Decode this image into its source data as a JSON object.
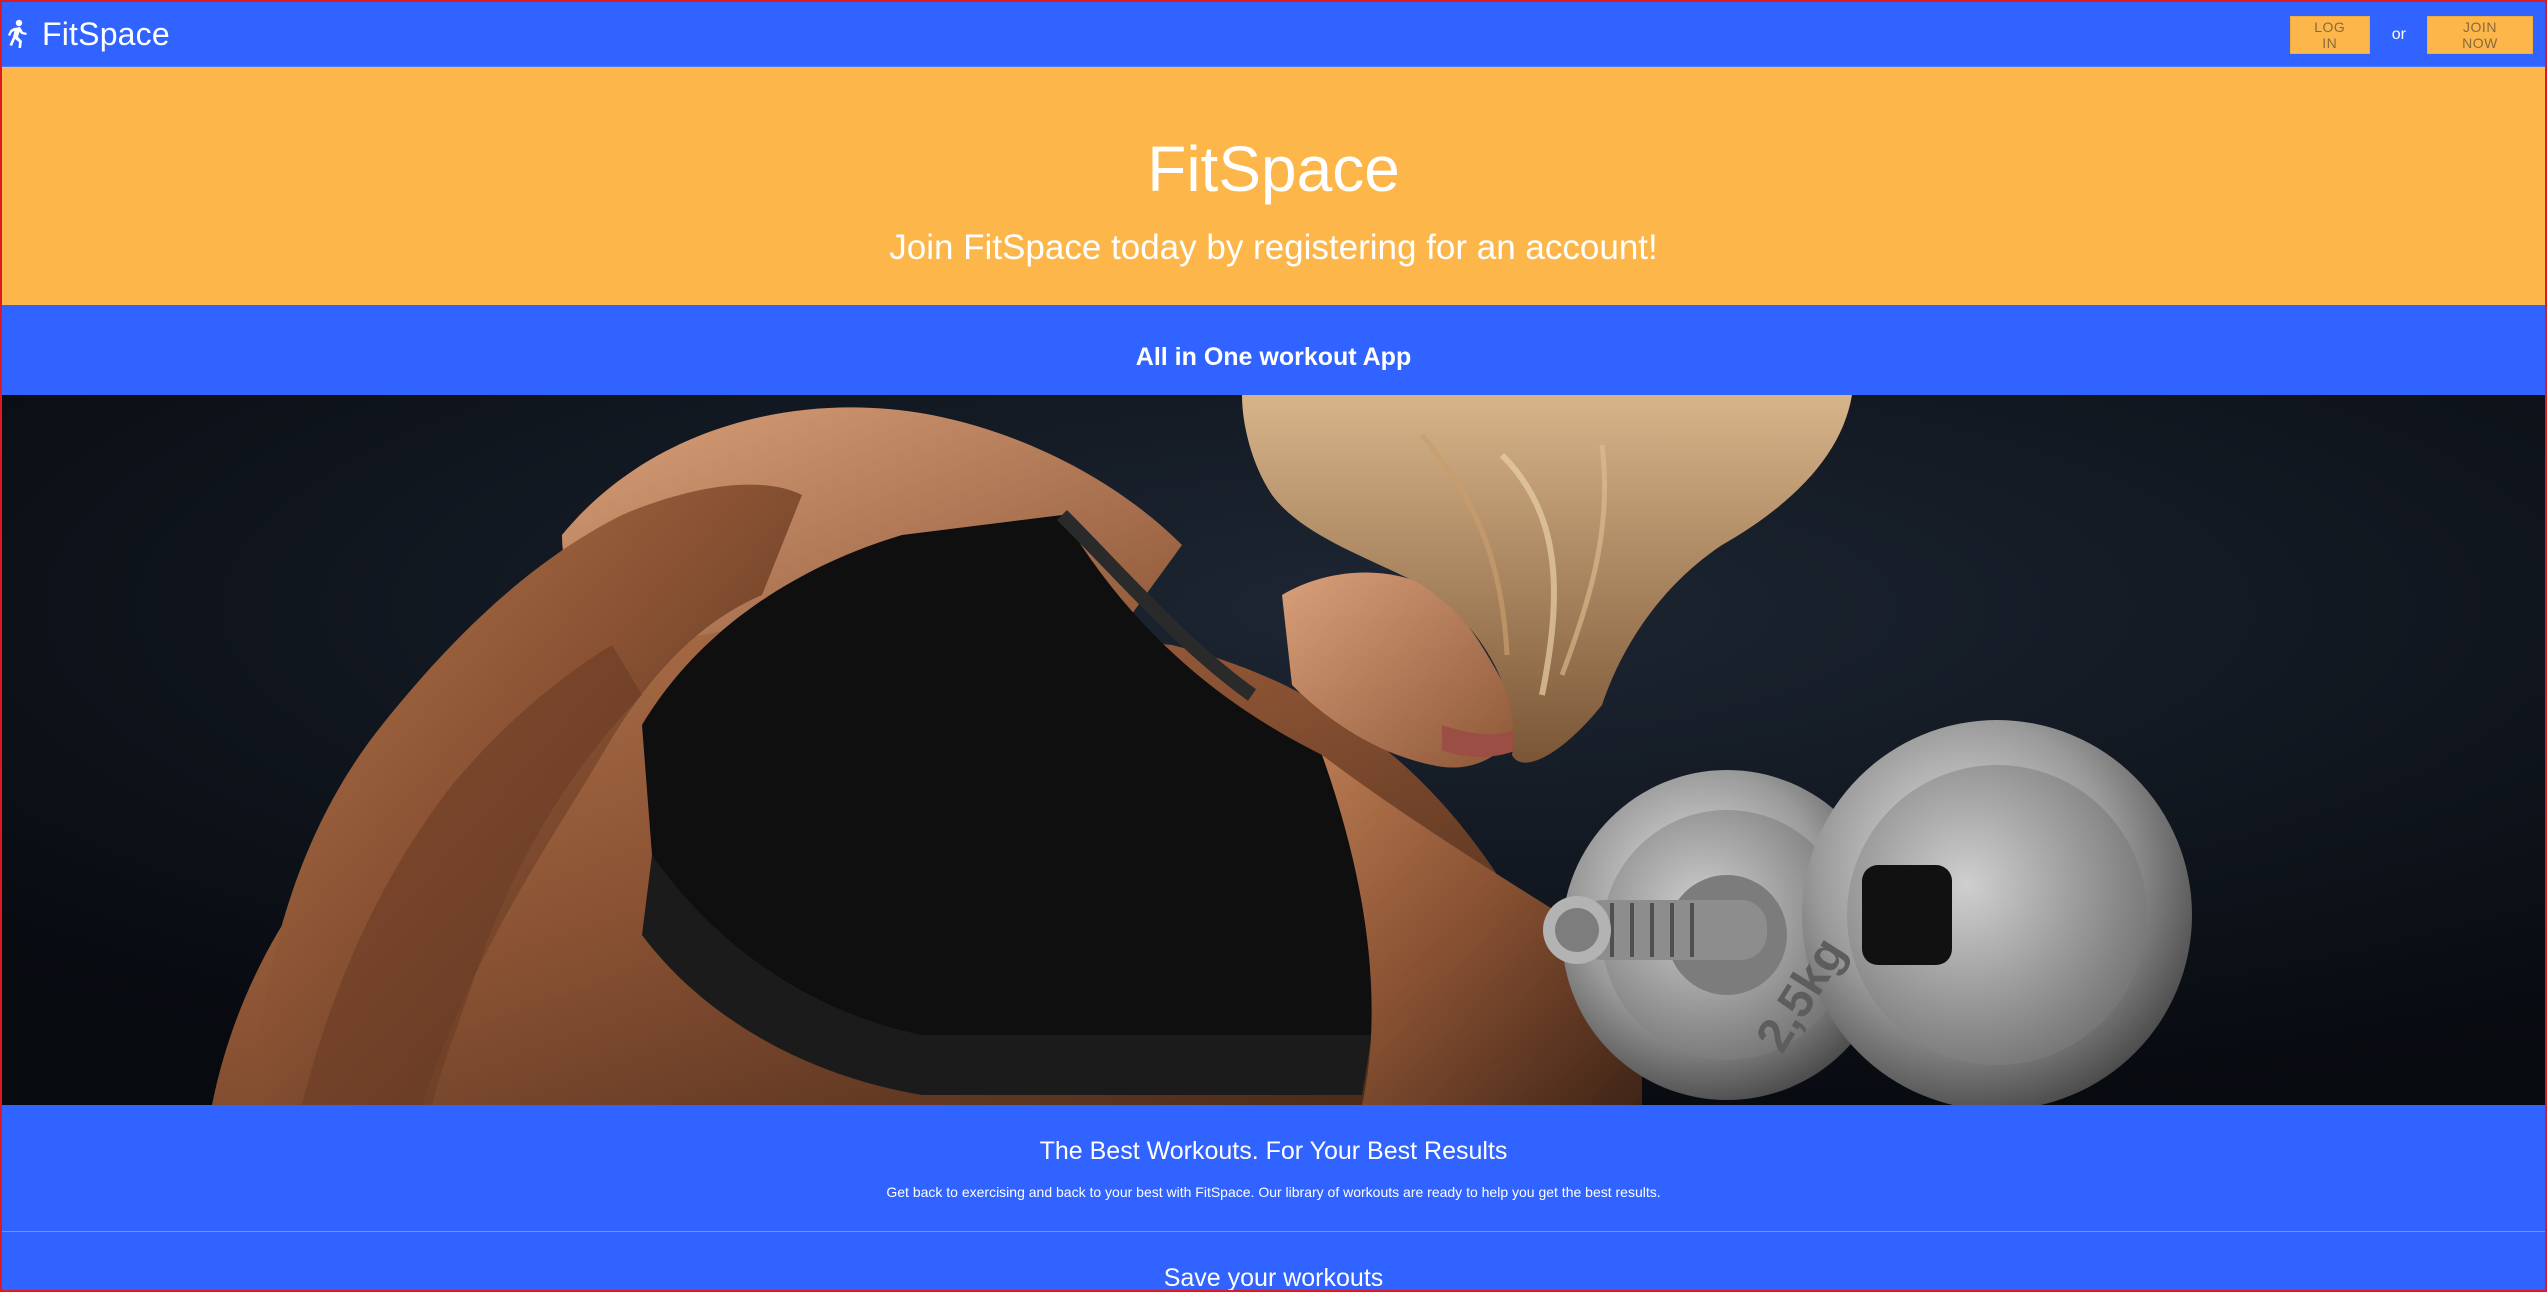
{
  "navbar": {
    "brand": "FitSpace",
    "brand_icon": "running-person-icon",
    "login_label": "LOG IN",
    "or_label": "or",
    "join_label": "JOIN NOW"
  },
  "hero": {
    "title": "FitSpace",
    "subtitle": "Join FitSpace today by registering for an account!"
  },
  "tagline": "All in One workout App",
  "photo": {
    "subject": "woman-lifting-dumbbell-photo",
    "plate_label": "2,5kg"
  },
  "features": [
    {
      "title": "The Best Workouts. For Your Best Results",
      "text": "Get back to exercising and back to your best with FitSpace. Our library of workouts are ready to help you get the best results."
    },
    {
      "title": "Save your workouts"
    }
  ],
  "colors": {
    "primary_blue": "#3063ff",
    "accent_orange": "#fdb64a",
    "frame_red": "#e0181f"
  }
}
